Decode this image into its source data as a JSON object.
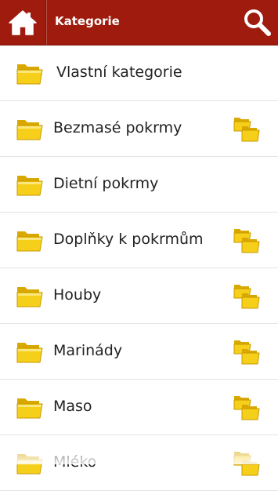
{
  "header": {
    "title": "Kategorie",
    "home_icon": "home-icon",
    "search_icon": "search-icon",
    "background": "#9e1b0e"
  },
  "categories": [
    {
      "label": "Vlastní kategorie",
      "has_subcategories": false
    },
    {
      "label": "Bezmasé pokrmy",
      "has_subcategories": true
    },
    {
      "label": "Dietní pokrmy",
      "has_subcategories": false
    },
    {
      "label": "Doplňky k pokrmům",
      "has_subcategories": true
    },
    {
      "label": "Houby",
      "has_subcategories": true
    },
    {
      "label": "Marinády",
      "has_subcategories": true
    },
    {
      "label": "Maso",
      "has_subcategories": true
    },
    {
      "label": "Mléko",
      "has_subcategories": true
    }
  ],
  "icons": {
    "folder": "folder-icon",
    "subfolders": "subfolders-icon",
    "folder_color": "#f5cf1a"
  }
}
